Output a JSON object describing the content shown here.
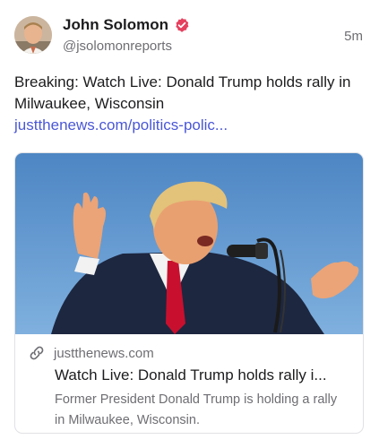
{
  "post": {
    "author": {
      "display_name": "John Solomon",
      "handle": "@jsolomonreports",
      "verified": true,
      "verified_color": "#e5405e"
    },
    "time": "5m",
    "text": "Breaking: Watch Live: Donald Trump holds rally in Milwaukee, Wisconsin",
    "link_text": "justthenews.com/politics-polic...",
    "link_color": "#4a57d6"
  },
  "card": {
    "domain": "justthenews.com",
    "title": "Watch Live: Donald Trump holds rally i...",
    "description": "Former President Donald Trump is holding a rally in Milwaukee, Wisconsin.",
    "link_icon": "link-icon"
  }
}
